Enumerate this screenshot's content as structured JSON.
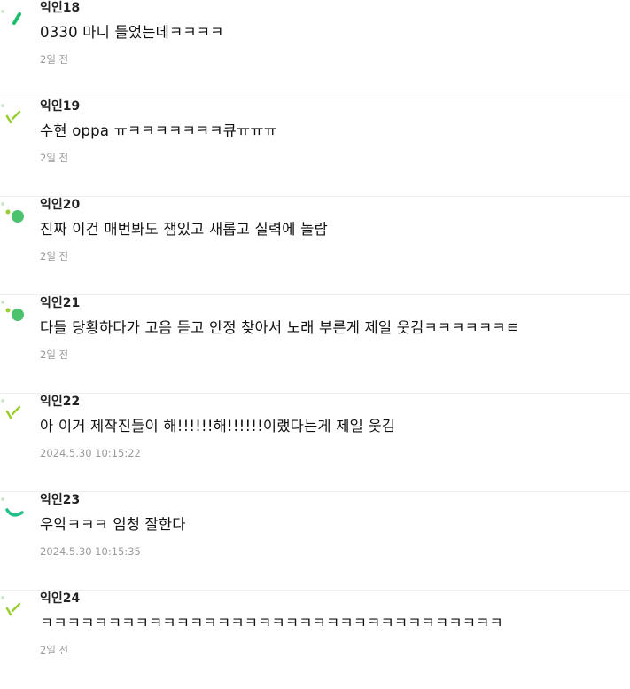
{
  "comments": [
    {
      "author": "익인18",
      "content": "0330 마니 들었는데ㅋㅋㅋㅋ",
      "time": "2일 전",
      "avatar_icon": "green-dash-icon",
      "avatar_color": "#1bbf6a"
    },
    {
      "author": "익인19",
      "content": "수현 oppa ㅠㅋㅋㅋㅋㅋㅋㅋ큐ㅠㅠㅠ",
      "time": "2일 전",
      "avatar_icon": "lime-check-icon",
      "avatar_color": "#9acd32"
    },
    {
      "author": "익인20",
      "content": "진짜 이건 매번봐도 잼있고 새롭고 실력에 놀람",
      "time": "2일 전",
      "avatar_icon": "green-dot-icon",
      "avatar_color": "#4cc26e"
    },
    {
      "author": "익인21",
      "content": "다들 당황하다가 고음 듣고 안정 찾아서 노래 부른게 제일 웃김ㅋㅋㅋㅋㅋㅋㅌ",
      "time": "2일 전",
      "avatar_icon": "green-dot-icon",
      "avatar_color": "#4cc26e"
    },
    {
      "author": "익인22",
      "content": "아 이거 제작진들이 해!!!!!!해!!!!!!이랬다는게 제일 웃김",
      "time": "2024.5.30 10:15:22",
      "avatar_icon": "lime-check-icon",
      "avatar_color": "#9acd32"
    },
    {
      "author": "익인23",
      "content": "우악ㅋㅋㅋ 엄청 잘한다",
      "time": "2024.5.30 10:15:35",
      "avatar_icon": "green-arc-icon",
      "avatar_color": "#1fbf88"
    },
    {
      "author": "익인24",
      "content": "ㅋㅋㅋㅋㅋㅋㅋㅋㅋㅋㅋㅋㅋㅋㅋㅋㅋㅋㅋㅋㅋㅋㅋㅋㅋㅋㅋㅋㅋㅋㅋㅋㅋㅋ",
      "time": "2일 전",
      "avatar_icon": "lime-check-icon",
      "avatar_color": "#9acd32"
    }
  ]
}
